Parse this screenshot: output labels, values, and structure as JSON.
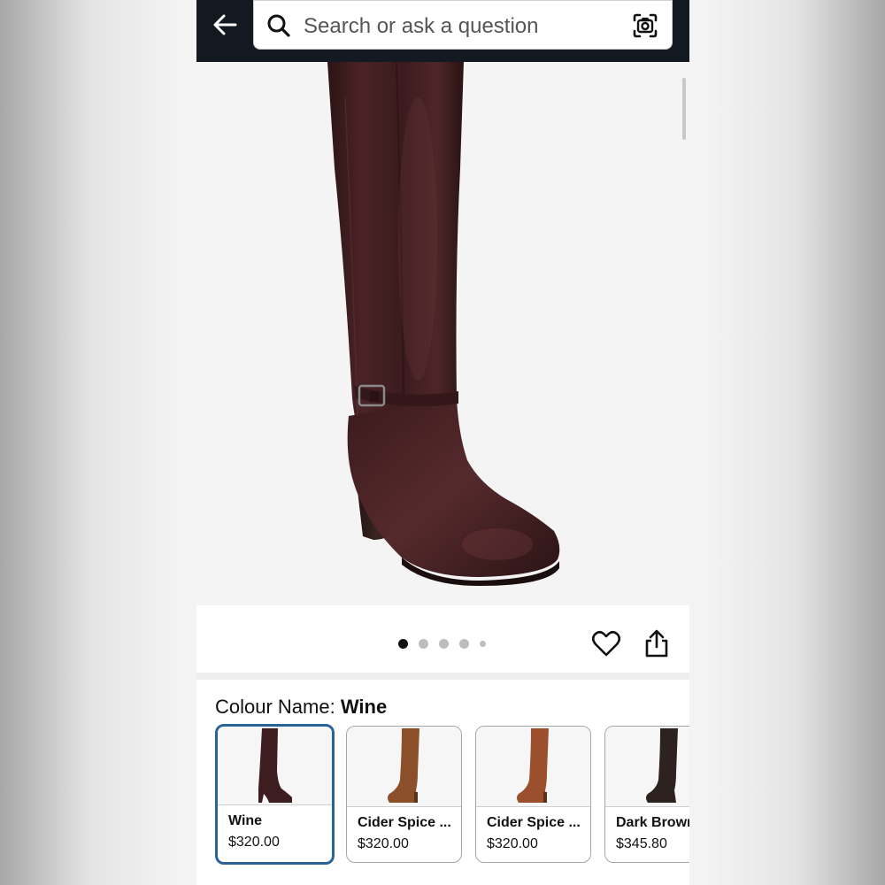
{
  "header": {
    "search_placeholder": "Search or ask a question",
    "back_icon": "arrow-left-icon",
    "camera_icon": "camera-lens-icon",
    "search_icon": "magnifier-icon",
    "bg_color": "#131921"
  },
  "product_image": {
    "alt": "Wine leather knee-high boot with ankle buckle strap and block heel",
    "color": "#3e1c1e"
  },
  "carousel": {
    "total_dots": 5,
    "active_index": 0
  },
  "actions": {
    "wishlist_icon": "heart-outline-icon",
    "share_icon": "share-icon"
  },
  "colour": {
    "label": "Colour Name:",
    "selected_value": "Wine",
    "options": [
      {
        "name": "Wine",
        "price": "$320.00",
        "selected": true,
        "color": "#3d1d1f"
      },
      {
        "name": "Cider Spice ...",
        "price": "$320.00",
        "selected": false,
        "color": "#8b4f2a"
      },
      {
        "name": "Cider Spice ...",
        "price": "$320.00",
        "selected": false,
        "color": "#9c4f2c"
      },
      {
        "name": "Dark Brown",
        "price": "$345.80",
        "selected": false,
        "color": "#2d2220"
      }
    ]
  }
}
